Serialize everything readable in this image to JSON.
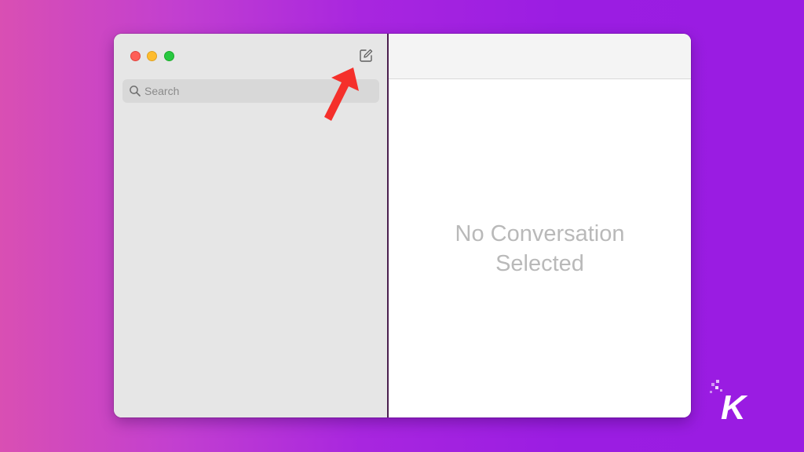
{
  "window": {
    "controls": {
      "close": "close",
      "minimize": "minimize",
      "zoom": "zoom"
    },
    "colors": {
      "close": "#fe5f57",
      "minimize": "#febc2e",
      "zoom": "#28c840"
    }
  },
  "sidebar": {
    "compose_icon": "compose-icon",
    "search": {
      "placeholder": "Search",
      "value": "",
      "icon": "search-icon"
    }
  },
  "main": {
    "empty_state": {
      "line1": "No Conversation",
      "line2": "Selected"
    }
  },
  "annotation": {
    "arrow_color": "#f5302b"
  },
  "brand": {
    "logo_letter": "K"
  }
}
